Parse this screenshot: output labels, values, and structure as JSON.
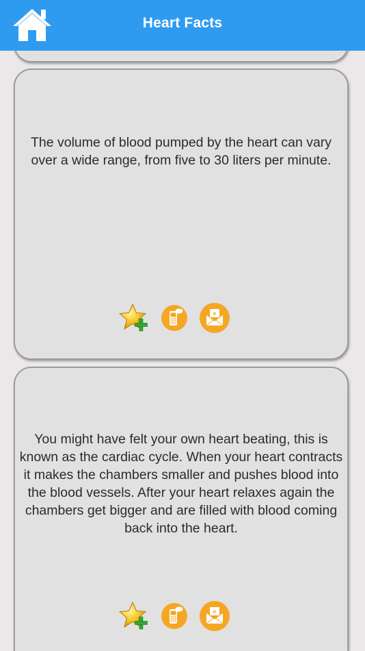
{
  "header": {
    "title": "Heart Facts",
    "home_icon": "home-icon",
    "background_color": "#2f9bf0"
  },
  "facts": [
    {
      "text": "The volume of blood pumped by the heart can vary over a wide range, from five to 30 liters per minute."
    },
    {
      "text": "You might have felt your own heart beating, this is known as the cardiac cycle. When your heart contracts it makes the chambers smaller and pushes blood into the blood vessels. After your heart relaxes again the chambers get bigger and are filled with blood coming back into the heart."
    }
  ],
  "actions": {
    "favorite_icon": "star-add-icon",
    "sms_icon": "sms-phone-icon",
    "email_icon": "email-envelope-icon",
    "accent_color": "#f5a623"
  }
}
